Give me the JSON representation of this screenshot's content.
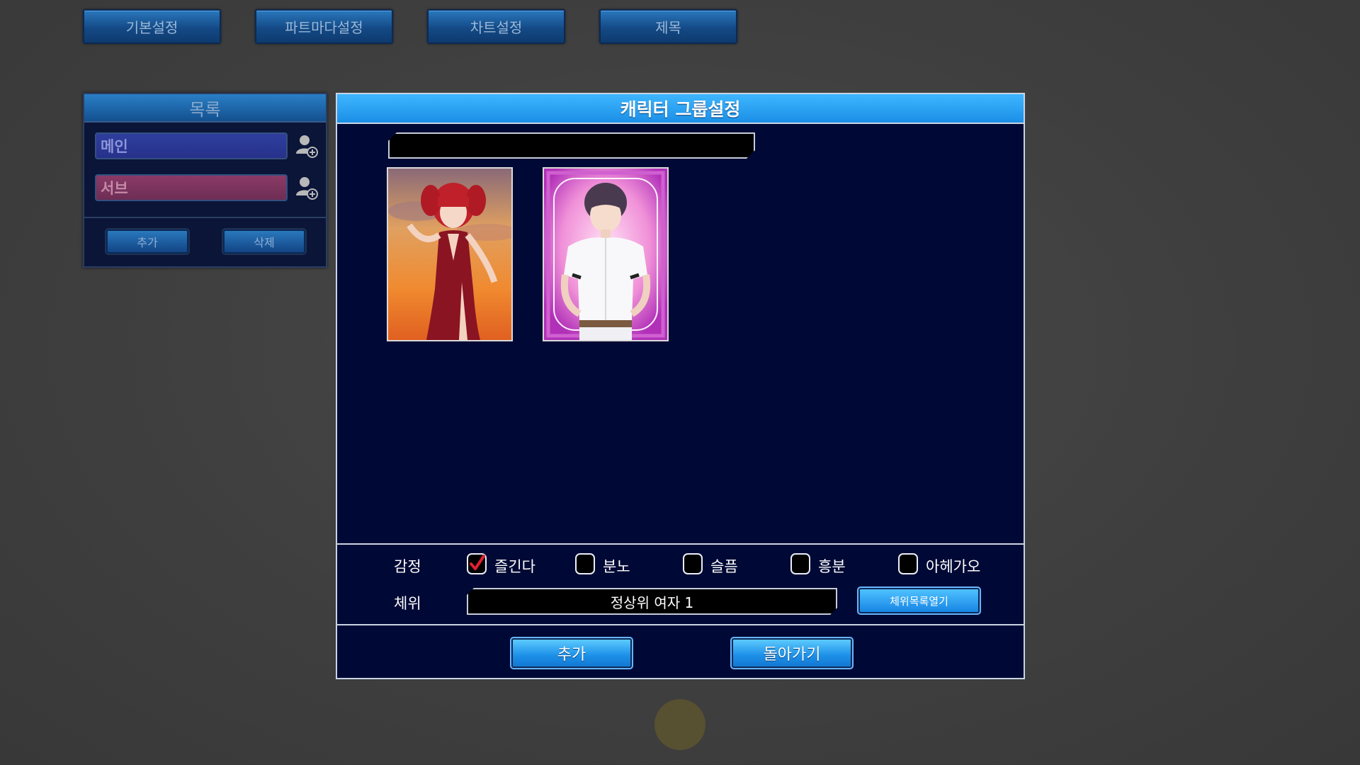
{
  "top_tabs": [
    "기본설정",
    "파트마다설정",
    "차트설정",
    "제목"
  ],
  "list_panel": {
    "title": "목록",
    "items": [
      {
        "label": "메인",
        "color": "#2f3e9e"
      },
      {
        "label": "서브",
        "color": "#8a3a66"
      }
    ],
    "add_label": "추가",
    "delete_label": "삭제"
  },
  "dialog": {
    "title": "캐릭터 그룹설정",
    "name_value": "",
    "cards": [
      {
        "name": "red-dress-girl-card"
      },
      {
        "name": "baseball-boy-card"
      }
    ],
    "emotion_label": "감정",
    "emotions": [
      {
        "label": "즐긴다",
        "checked": true
      },
      {
        "label": "분노",
        "checked": false
      },
      {
        "label": "슬픔",
        "checked": false
      },
      {
        "label": "흥분",
        "checked": false
      },
      {
        "label": "아헤가오",
        "checked": false
      }
    ],
    "pose_label": "체위",
    "pose_value": "정상위 여자 1",
    "pose_list_button": "체위목록열기",
    "add_button": "추가",
    "back_button": "돌아가기"
  },
  "colors": {
    "accent": "#1a8fe6",
    "dialog_bg": "#000935",
    "check_mark": "#e02030"
  }
}
